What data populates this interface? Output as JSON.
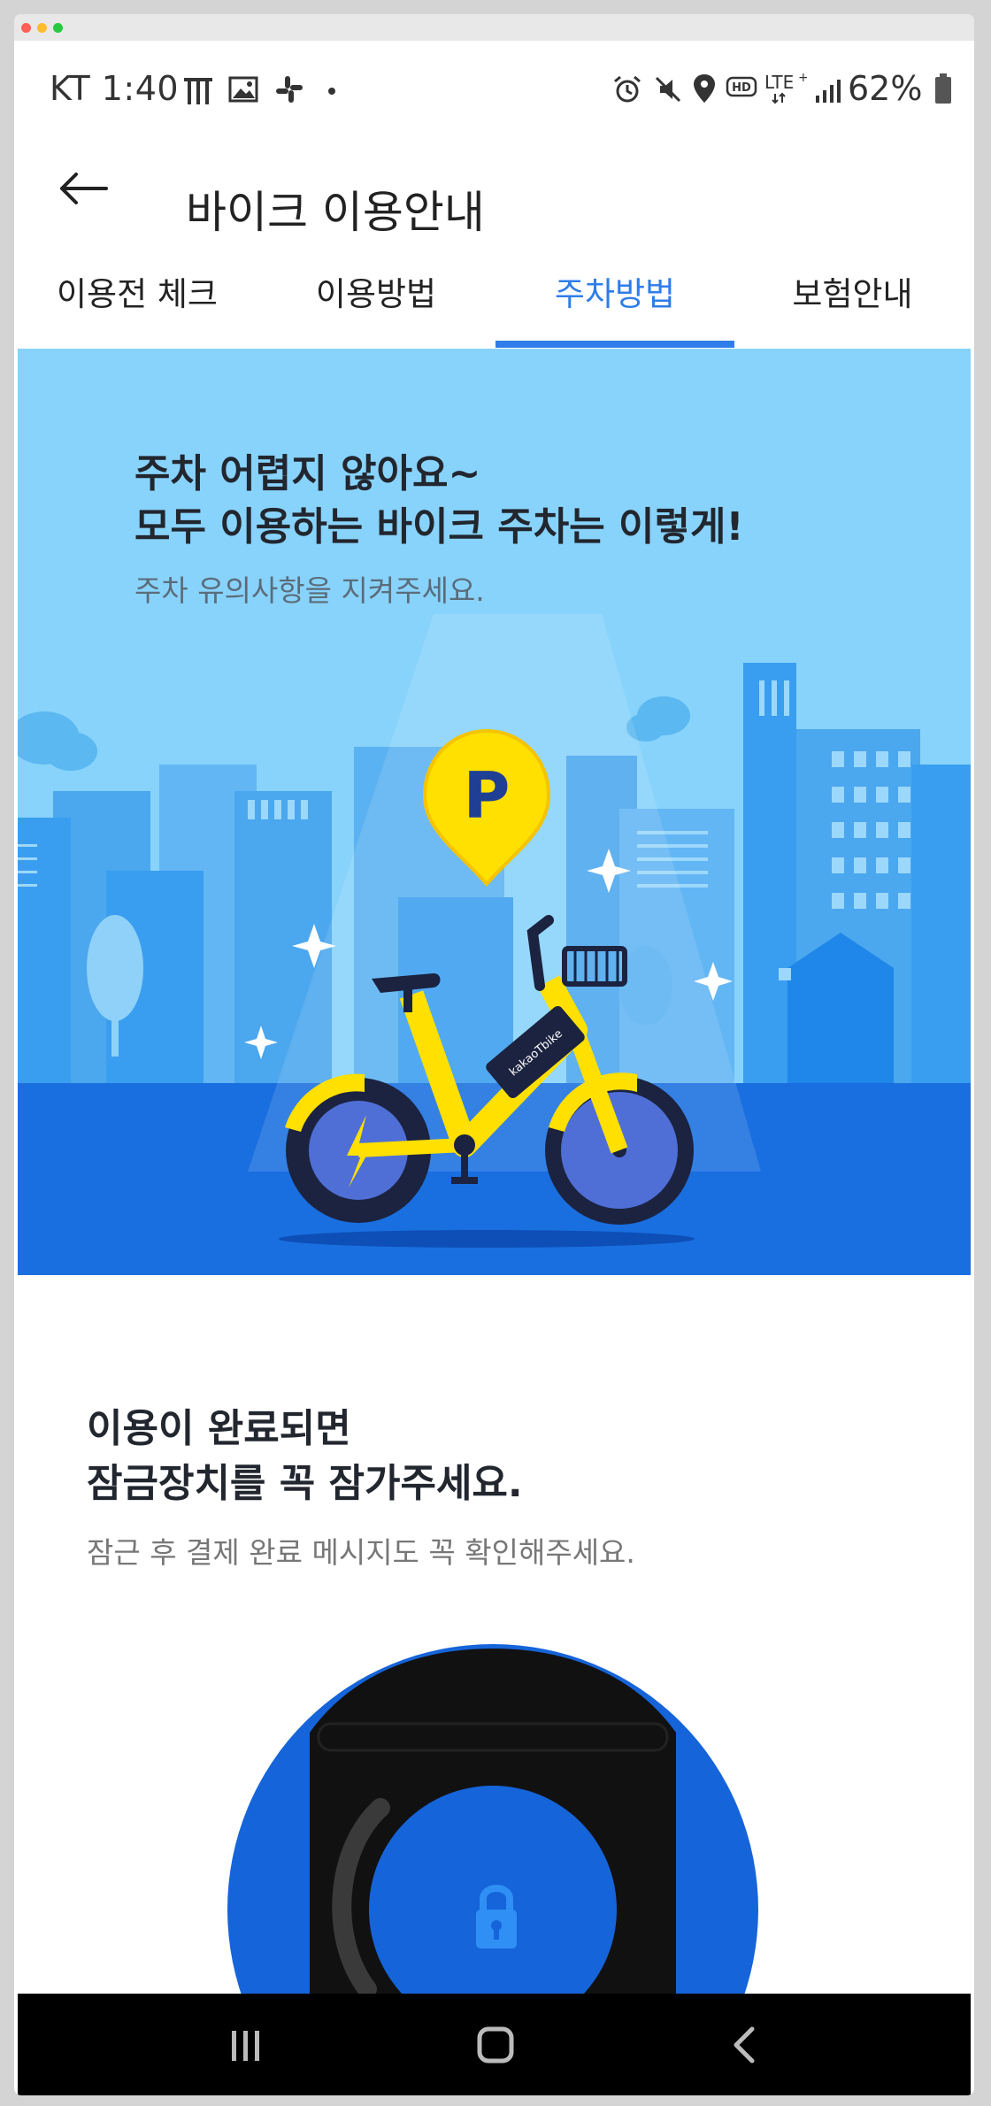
{
  "status_bar": {
    "carrier_time": "KT 1:40",
    "battery_percent": "62%",
    "icons": [
      "tmap-icon",
      "gallery-icon",
      "slack-icon",
      "dot-icon",
      "alarm-icon",
      "mute-icon",
      "location-icon",
      "hd-icon",
      "lte-icon",
      "signal-icon",
      "battery-icon"
    ]
  },
  "header": {
    "back_icon": "arrow-left-icon",
    "title": "바이크 이용안내"
  },
  "tabs": [
    {
      "label": "이용전 체크",
      "active": false
    },
    {
      "label": "이용방법",
      "active": false
    },
    {
      "label": "주차방법",
      "active": true
    },
    {
      "label": "보험안내",
      "active": false
    }
  ],
  "hero": {
    "heading_line1": "주차 어렵지 않아요~",
    "heading_line2": "모두 이용하는 바이크 주차는 이렇게!",
    "subtext": "주차 유의사항을 지켜주세요.",
    "parking_badge": "P",
    "bike_label": "kakaoTbike"
  },
  "section_lock": {
    "heading_line1": "이용이 완료되면",
    "heading_line2": "잠금장치를 꼭 잠가주세요.",
    "subtext": "잠근 후 결제 완료 메시지도 꼭 확인해주세요."
  },
  "nav_bar": {
    "buttons": [
      "recent-apps-icon",
      "home-icon",
      "back-icon"
    ]
  },
  "colors": {
    "accent": "#2f7de8",
    "hero_bg": "#88d3fb",
    "ground": "#1a6fe0",
    "bike_yellow": "#ffe000",
    "navbar": "#000000"
  }
}
